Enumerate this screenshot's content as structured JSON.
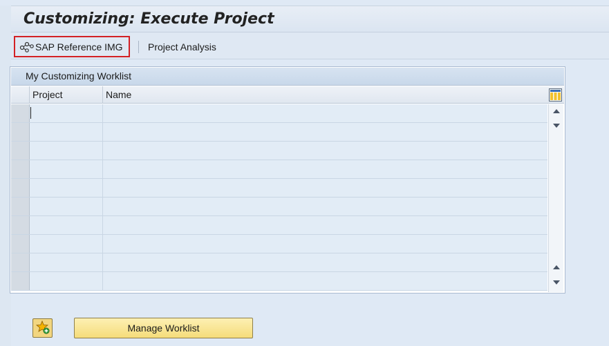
{
  "window": {
    "title": "Customizing: Execute Project"
  },
  "toolbar": {
    "items": [
      {
        "label": "SAP Reference IMG",
        "icon": "img-structure-icon",
        "highlighted": true
      },
      {
        "label": "Project Analysis"
      }
    ]
  },
  "worklist": {
    "title": "My Customizing Worklist",
    "columns": [
      "Project",
      "Name"
    ],
    "rows": [
      {
        "project": "",
        "name": ""
      },
      {
        "project": "",
        "name": ""
      },
      {
        "project": "",
        "name": ""
      },
      {
        "project": "",
        "name": ""
      },
      {
        "project": "",
        "name": ""
      },
      {
        "project": "",
        "name": ""
      },
      {
        "project": "",
        "name": ""
      },
      {
        "project": "",
        "name": ""
      },
      {
        "project": "",
        "name": ""
      },
      {
        "project": "",
        "name": ""
      }
    ]
  },
  "footer": {
    "add_favorite_icon": "star-add-icon",
    "manage_label": "Manage Worklist"
  },
  "colors": {
    "highlight_border": "#d32024",
    "button_yellow": "#f5dc7a",
    "row_background": "#e2ecf6"
  }
}
